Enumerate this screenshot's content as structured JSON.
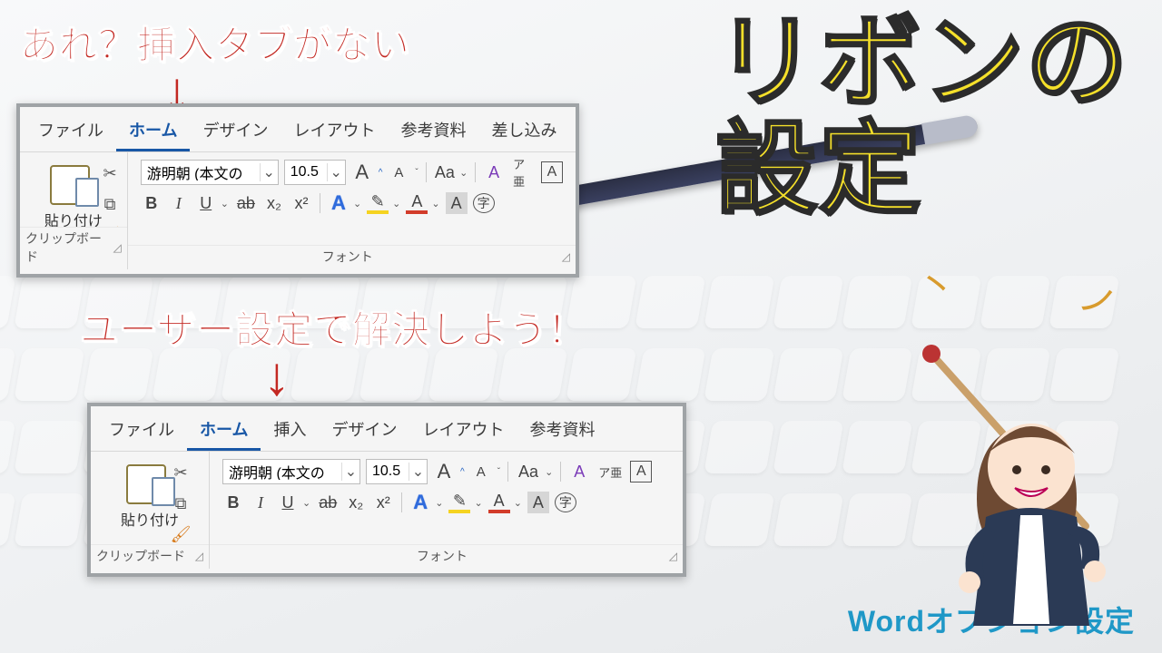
{
  "title_line1": "リボンの",
  "title_line2": "設定",
  "callout_top": "あれ？挿入タブがない",
  "callout_mid": "ユーザー設定で解決しよう！",
  "subtitle": "Wordオプション設定",
  "arrow": "↓",
  "ribbon1": {
    "tabs": [
      "ファイル",
      "ホーム",
      "デザイン",
      "レイアウト",
      "参考資料",
      "差し込み"
    ],
    "active_tab_index": 1,
    "font_name": "游明朝 (本文の",
    "font_size": "10.5",
    "paste_label": "貼り付け",
    "group_clipboard": "クリップボード",
    "group_font": "フォント",
    "btns": {
      "grow": "A",
      "shrink": "A",
      "case": "Aa",
      "clear": "A",
      "ruby": "ア亜",
      "border": "A",
      "bold": "B",
      "italic": "I",
      "underline": "U",
      "strike": "ab",
      "sub": "x₂",
      "sup": "x²",
      "textfx": "A",
      "highlight": "✎",
      "fontcolor": "A",
      "shade": "A",
      "enclose": "字"
    }
  },
  "ribbon2": {
    "tabs": [
      "ファイル",
      "ホーム",
      "挿入",
      "デザイン",
      "レイアウト",
      "参考資料"
    ],
    "active_tab_index": 1,
    "font_name": "游明朝 (本文の",
    "font_size": "10.5",
    "paste_label": "貼り付け",
    "group_clipboard": "クリップボード",
    "group_font": "フォント"
  }
}
